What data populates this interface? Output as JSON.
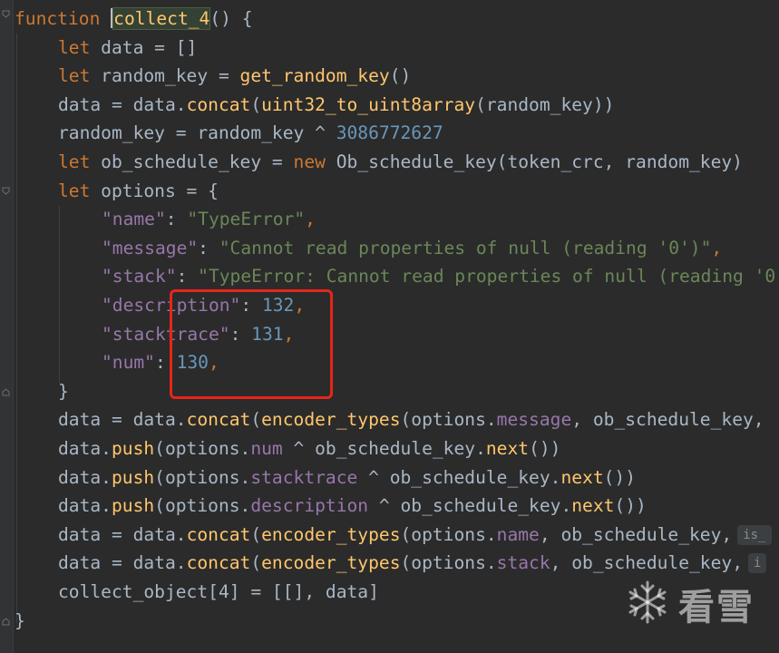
{
  "colors": {
    "background": "#2b2b2b",
    "keyword": "#cc7832",
    "function": "#ffc66d",
    "number": "#6897bb",
    "string": "#6a8759",
    "property": "#9876aa",
    "text": "#a9b7c6",
    "highlight_box": "#e5261a"
  },
  "code": {
    "l1": {
      "kw": "function",
      "name": "collect_4",
      "rest": "() {"
    },
    "l2": {
      "kw": "let",
      "rest": " data = []"
    },
    "l3": {
      "kw": "let",
      "a": " random_key = ",
      "fn": "get_random_key",
      "b": "()"
    },
    "l4": {
      "a": "data = data.",
      "fn1": "concat",
      "b": "(",
      "fn2": "uint32_to_uint8array",
      "c": "(random_key))"
    },
    "l5": {
      "a": "random_key = random_key ^ ",
      "num": "3086772627"
    },
    "l6": {
      "kw1": "let",
      "a": " ob_schedule_key = ",
      "kw2": "new",
      "b": " Ob_schedule_key(token_crc, random_key)"
    },
    "l7": {
      "kw": "let",
      "rest": " options = {"
    },
    "l8": {
      "key": "\"name\"",
      "sep": ": ",
      "val": "\"TypeError\"",
      "end": ","
    },
    "l9": {
      "key": "\"message\"",
      "sep": ": ",
      "val": "\"Cannot read properties of null (reading '0')\"",
      "end": ","
    },
    "l10": {
      "key": "\"stack\"",
      "sep": ": ",
      "val": "\"TypeError: Cannot read properties of null (reading '0"
    },
    "l11": {
      "key": "\"description\"",
      "sep": ": ",
      "val": "132",
      "end": ","
    },
    "l12": {
      "key": "\"stacktrace\"",
      "sep": ": ",
      "val": "131",
      "end": ","
    },
    "l13": {
      "key": "\"num\"",
      "sep": ": ",
      "val": "130",
      "end": ","
    },
    "l14": {
      "rest": "}"
    },
    "l15": {
      "a": "data = data.",
      "fn1": "concat",
      "b": "(",
      "fn2": "encoder_types",
      "c": "(options.",
      "prop": "message",
      "d": ", ob_schedule_key,"
    },
    "l16": {
      "a": "data.",
      "fn": "push",
      "b": "(options.",
      "prop": "num",
      "c": " ^ ob_schedule_key.",
      "fn2": "next",
      "d": "())"
    },
    "l17": {
      "a": "data.",
      "fn": "push",
      "b": "(options.",
      "prop": "stacktrace",
      "c": " ^ ob_schedule_key.",
      "fn2": "next",
      "d": "())"
    },
    "l18": {
      "a": "data.",
      "fn": "push",
      "b": "(options.",
      "prop": "description",
      "c": " ^ ob_schedule_key.",
      "fn2": "next",
      "d": "())"
    },
    "l19": {
      "a": "data = data.",
      "fn1": "concat",
      "b": "(",
      "fn2": "encoder_types",
      "c": "(options.",
      "prop": "name",
      "d": ", ob_schedule_key,",
      "hint": "is_"
    },
    "l20": {
      "a": "data = data.",
      "fn1": "concat",
      "b": "(",
      "fn2": "encoder_types",
      "c": "(options.",
      "prop": "stack",
      "d": ", ob_schedule_key,",
      "hint": "i"
    },
    "l21": {
      "rest": "collect_object[4] = [[], data]"
    },
    "l22": {
      "rest": "}"
    }
  },
  "watermark": {
    "text": "看雪",
    "icon": "snowflake-icon"
  }
}
